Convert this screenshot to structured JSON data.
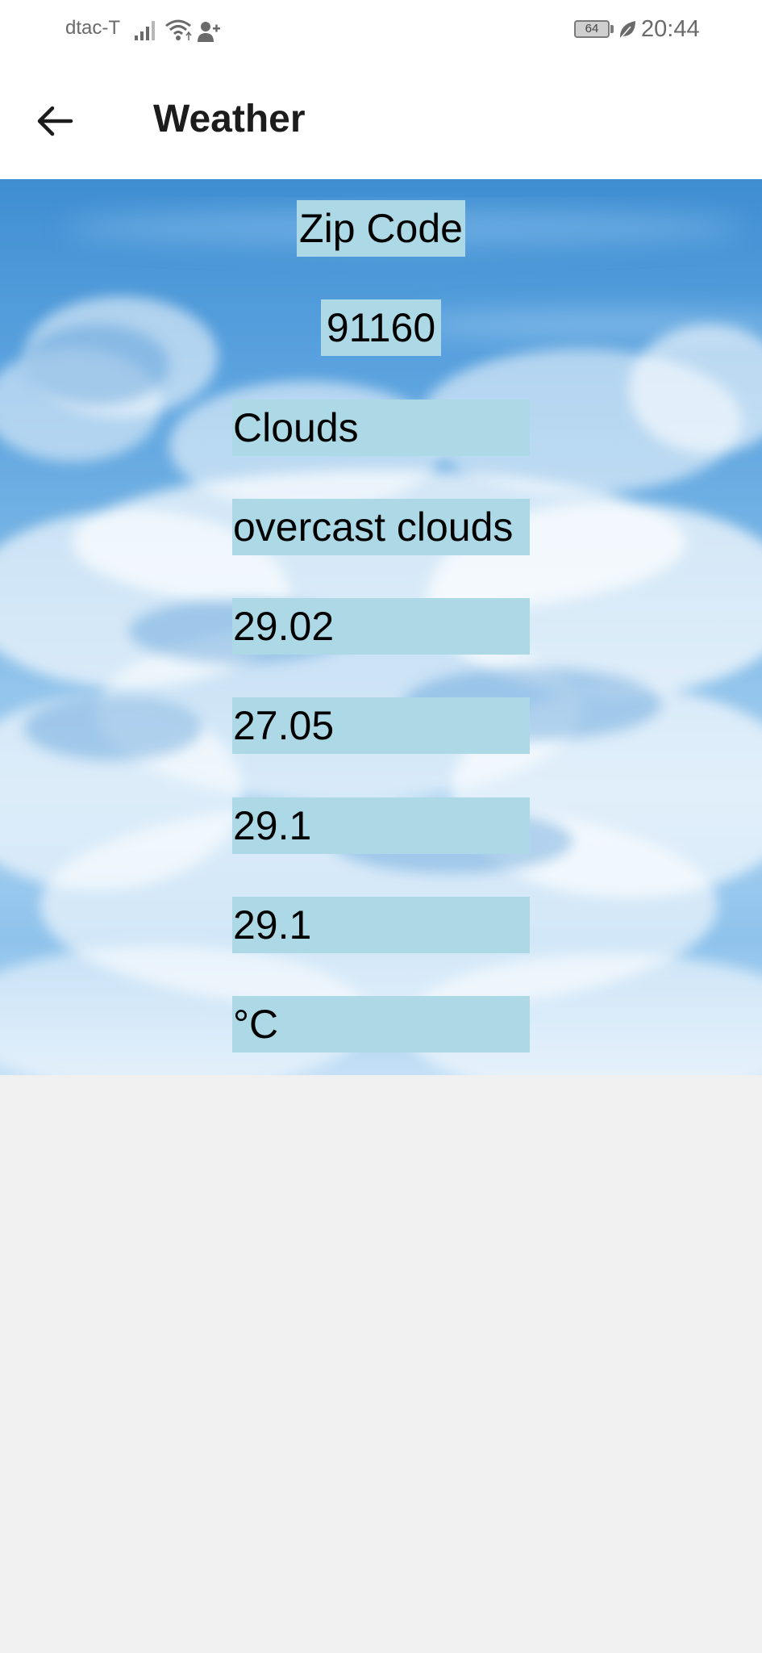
{
  "status_bar": {
    "carrier": "dtac-T",
    "battery_level": "64",
    "time": "20:44"
  },
  "app_bar": {
    "title": "Weather",
    "back_icon": "arrow-left-icon"
  },
  "weather": {
    "zip_label": "Zip Code",
    "zip_value": "91160",
    "main": "Clouds",
    "description": "overcast clouds",
    "temp": "29.02",
    "feels_like": "27.05",
    "temp_min": "29.1",
    "temp_max": "29.1",
    "unit": "°C"
  },
  "colors": {
    "label_background": "#add8e6",
    "app_bar_background": "#ffffff",
    "page_background": "#f0f0f0"
  }
}
